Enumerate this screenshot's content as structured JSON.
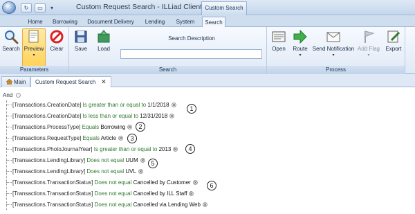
{
  "window": {
    "title": "Custom Request Search - ILLiad Client",
    "context_tab_title": "Custom Search"
  },
  "ribbon_tabs": [
    {
      "label": "Home"
    },
    {
      "label": "Borrowing"
    },
    {
      "label": "Document Delivery"
    },
    {
      "label": "Lending"
    },
    {
      "label": "System"
    },
    {
      "label": "Search",
      "active": true
    }
  ],
  "ribbon": {
    "parameters": {
      "label": "Parameters",
      "search": "Search",
      "preview": "Preview",
      "clear": "Clear"
    },
    "search": {
      "label": "Search",
      "save": "Save",
      "load": "Load",
      "description_label": "Search Description",
      "description_value": ""
    },
    "process": {
      "label": "Process",
      "open": "Open",
      "route": "Route",
      "send_notification": "Send Notification",
      "add_flag": "Add Flag",
      "export": "Export"
    }
  },
  "doc_tabs": [
    {
      "label": "Main"
    },
    {
      "label": "Custom Request Search",
      "active": true
    }
  ],
  "query": {
    "root": "And",
    "conditions": [
      {
        "field": "[Transactions.CreationDate]",
        "op": "Is greater than or equal to",
        "value": "1/1/2018"
      },
      {
        "field": "[Transactions.CreationDate]",
        "op": "Is less than or equal to",
        "value": "12/31/2018"
      },
      {
        "field": "[Transactions.ProcessType]",
        "op": "Equals",
        "value": "Borrowing"
      },
      {
        "field": "[Transactions.RequestType]",
        "op": "Equals",
        "value": "Article"
      },
      {
        "field": "[Transactions.PhotoJournalYear]",
        "op": "Is greater than or equal to",
        "value": "2013"
      },
      {
        "field": "[Transactions.LendingLibrary]",
        "op": "Does not equal",
        "value": "UUM"
      },
      {
        "field": "[Transactions.LendingLibrary]",
        "op": "Does not equal",
        "value": "UVL"
      },
      {
        "field": "[Transactions.TransactionStatus]",
        "op": "Does not equal",
        "value": "Cancelled by Customer"
      },
      {
        "field": "[Transactions.TransactionStatus]",
        "op": "Does not equal",
        "value": "Cancelled by ILL Staff"
      },
      {
        "field": "[Transactions.TransactionStatus]",
        "op": "Does not equal",
        "value": "Cancelled via Lending Web"
      }
    ]
  },
  "callouts": [
    "1",
    "2",
    "3",
    "4",
    "5",
    "6"
  ],
  "colors": {
    "operator": "#2e7a2e",
    "ribbon_bg": "#dfe9f5",
    "pressed": "#ffd35a"
  }
}
